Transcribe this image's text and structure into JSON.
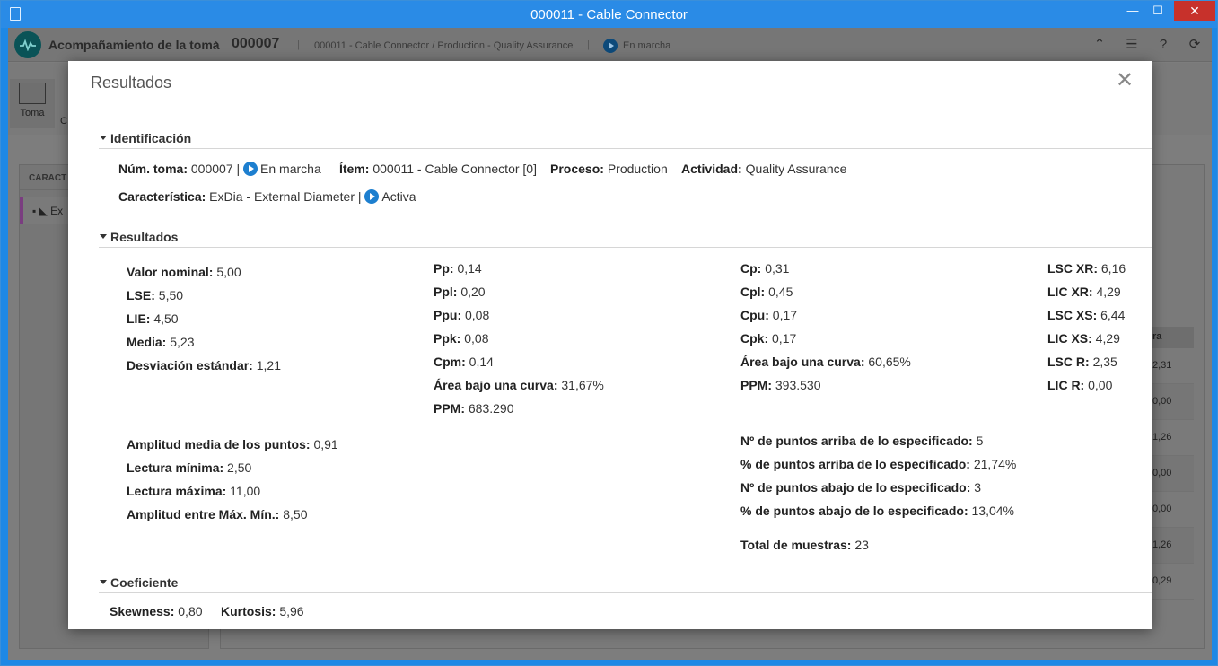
{
  "window": {
    "title": "000011 - Cable Connector",
    "min": "—",
    "max": "☐",
    "close": "✕"
  },
  "app": {
    "breadcrumb_root": "Acompañamiento de la toma",
    "breadcrumb_sep": "›",
    "breadcrumb_id": "000007",
    "breadcrumb_path": "000011 - Cable Connector / Production - Quality Assurance",
    "status": "En marcha",
    "toolbar_toma": "Toma",
    "toolbar_c": "C",
    "left_header": "CARACT",
    "left_item": "Ex",
    "right_col_header": "ra",
    "right_col_values": [
      "2,31",
      "0,00",
      "1,26",
      "0,00",
      "0,00",
      "1,26",
      "0,29"
    ]
  },
  "modal": {
    "title": "Resultados",
    "close": "✕"
  },
  "identificacion": {
    "title": "Identificación",
    "num_toma_label": "Núm. toma:",
    "num_toma_value": "000007 |",
    "num_toma_status": "En marcha",
    "item_label": "Ítem:",
    "item_value": "000011 - Cable Connector [0]",
    "proceso_label": "Proceso:",
    "proceso_value": "Production",
    "actividad_label": "Actividad:",
    "actividad_value": "Quality Assurance",
    "caracteristica_label": "Característica:",
    "caracteristica_value": "ExDia - External Diameter |",
    "caracteristica_status": "Activa"
  },
  "resultados": {
    "title": "Resultados",
    "col1": [
      {
        "label": "Valor nominal:",
        "value": "5,00"
      },
      {
        "label": "LSE:",
        "value": "5,50"
      },
      {
        "label": "LIE:",
        "value": "4,50"
      },
      {
        "label": "Media:",
        "value": "5,23"
      },
      {
        "label": "Desviación estándar:",
        "value": "1,21"
      }
    ],
    "col1b": [
      {
        "label": "Amplitud media de los puntos:",
        "value": "0,91"
      },
      {
        "label": "Lectura mínima:",
        "value": "2,50"
      },
      {
        "label": "Lectura máxima:",
        "value": "11,00"
      },
      {
        "label": "Amplitud entre Máx. Mín.:",
        "value": "8,50"
      }
    ],
    "col2": [
      {
        "label": "Pp:",
        "value": "0,14"
      },
      {
        "label": "Ppl:",
        "value": "0,20"
      },
      {
        "label": "Ppu:",
        "value": "0,08"
      },
      {
        "label": "Ppk:",
        "value": "0,08"
      },
      {
        "label": "Cpm:",
        "value": "0,14"
      },
      {
        "label": "Área bajo una curva:",
        "value": "31,67%"
      },
      {
        "label": "PPM:",
        "value": "683.290"
      }
    ],
    "col3": [
      {
        "label": "Cp:",
        "value": "0,31"
      },
      {
        "label": "Cpl:",
        "value": "0,45"
      },
      {
        "label": "Cpu:",
        "value": "0,17"
      },
      {
        "label": "Cpk:",
        "value": "0,17"
      },
      {
        "label": "Área bajo una curva:",
        "value": "60,65%"
      },
      {
        "label": "PPM:",
        "value": "393.530"
      }
    ],
    "col3b": [
      {
        "label": "Nº de puntos arriba de lo especificado:",
        "value": "5"
      },
      {
        "label": "% de puntos arriba de lo especificado:",
        "value": "21,74%"
      },
      {
        "label": "Nº de puntos abajo de lo especificado:",
        "value": "3"
      },
      {
        "label": "% de puntos abajo de lo especificado:",
        "value": "13,04%"
      }
    ],
    "total": {
      "label": "Total de muestras:",
      "value": "23"
    },
    "col4": [
      {
        "label": "LSC XR:",
        "value": "6,16"
      },
      {
        "label": "LIC XR:",
        "value": "4,29"
      },
      {
        "label": "LSC XS:",
        "value": "6,44"
      },
      {
        "label": "LIC XS:",
        "value": "4,29"
      },
      {
        "label": "LSC R:",
        "value": "2,35"
      },
      {
        "label": "LIC R:",
        "value": "0,00"
      }
    ]
  },
  "coeficiente": {
    "title": "Coeficiente",
    "skewness_label": "Skewness:",
    "skewness_value": "0,80",
    "kurtosis_label": "Kurtosis:",
    "kurtosis_value": "5,96"
  }
}
